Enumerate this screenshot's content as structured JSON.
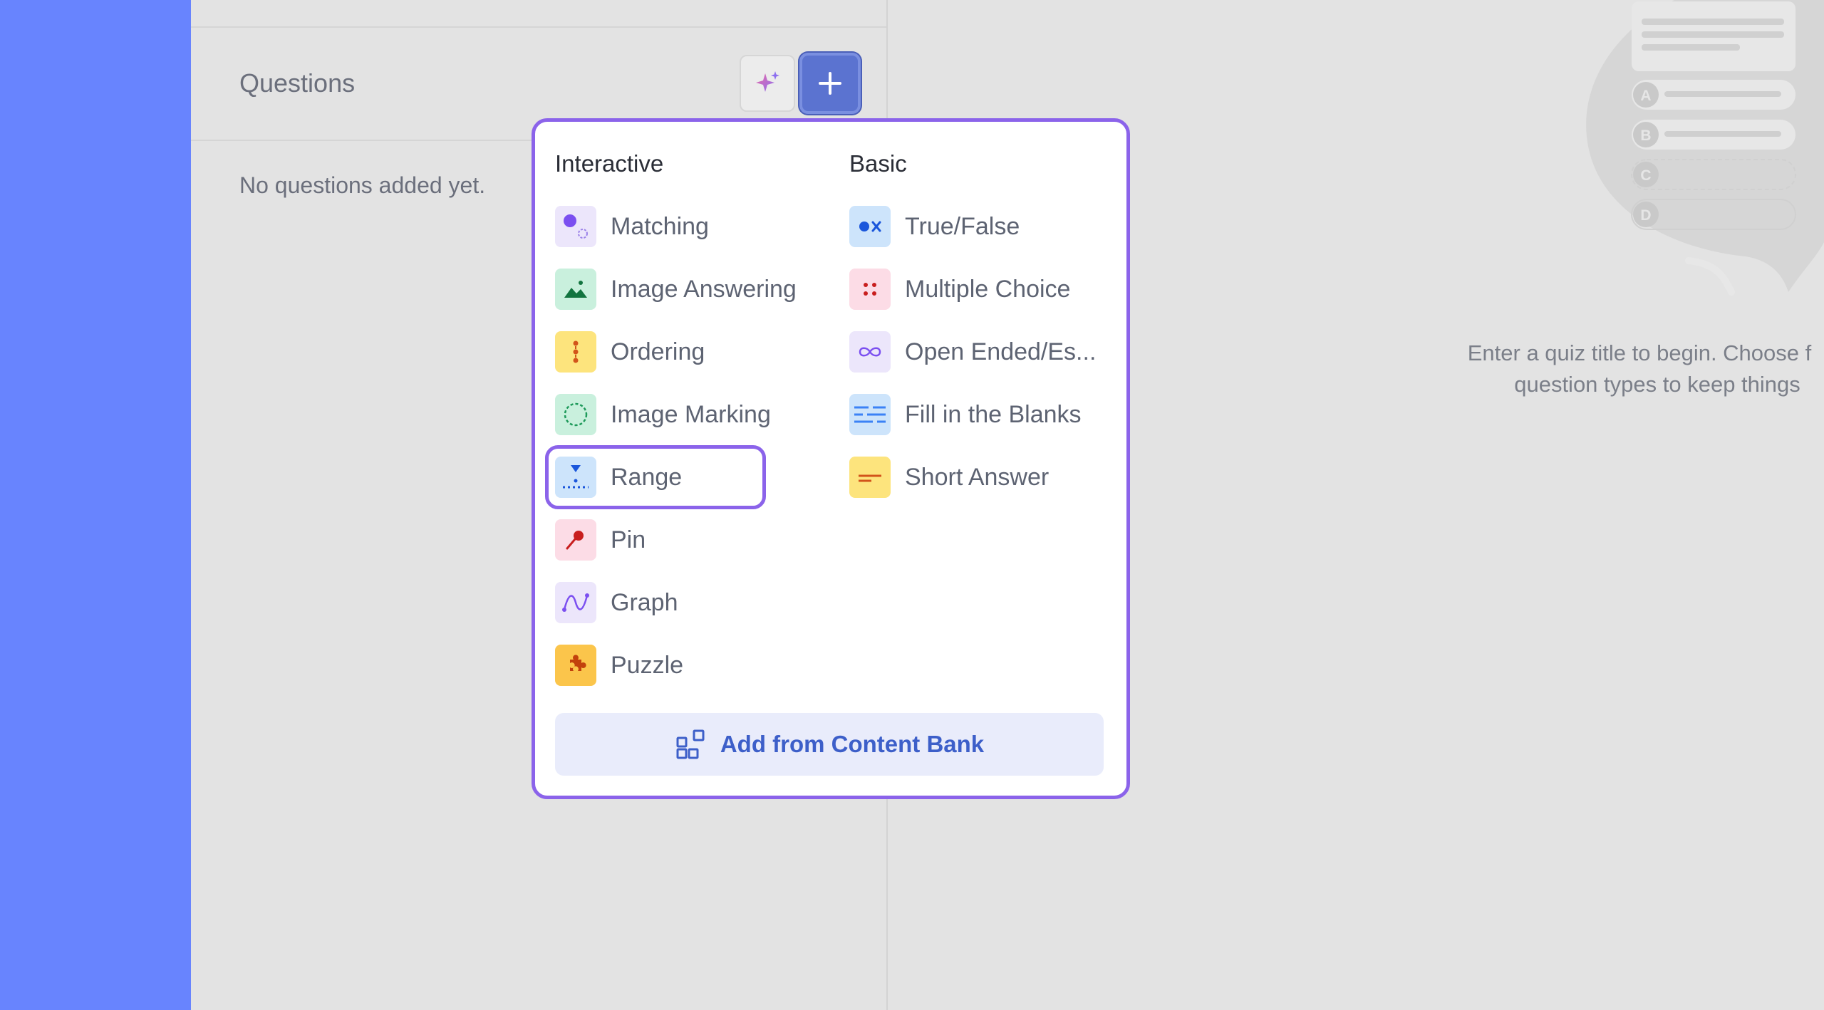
{
  "questions_panel": {
    "title": "Questions",
    "empty_message": "No questions added yet."
  },
  "preview": {
    "intro_line1": "Enter a quiz title to begin. Choose f",
    "intro_line2": "question types to keep things",
    "option_letters": [
      "A",
      "B",
      "C",
      "D"
    ]
  },
  "menu": {
    "interactive_heading": "Interactive",
    "basic_heading": "Basic",
    "interactive_items": [
      {
        "label": "Matching",
        "icon": "matching-icon"
      },
      {
        "label": "Image Answering",
        "icon": "image-answering-icon"
      },
      {
        "label": "Ordering",
        "icon": "ordering-icon"
      },
      {
        "label": "Image Marking",
        "icon": "image-marking-icon"
      },
      {
        "label": "Range",
        "icon": "range-icon"
      },
      {
        "label": "Pin",
        "icon": "pin-icon"
      },
      {
        "label": "Graph",
        "icon": "graph-icon"
      },
      {
        "label": "Puzzle",
        "icon": "puzzle-icon"
      }
    ],
    "basic_items": [
      {
        "label": "True/False",
        "icon": "true-false-icon"
      },
      {
        "label": "Multiple Choice",
        "icon": "multiple-choice-icon"
      },
      {
        "label": "Open Ended/Es...",
        "icon": "open-ended-icon"
      },
      {
        "label": "Fill in the Blanks",
        "icon": "fill-blanks-icon"
      },
      {
        "label": "Short Answer",
        "icon": "short-answer-icon"
      }
    ],
    "content_bank_label": "Add from Content Bank"
  },
  "colors": {
    "left_rail": "#6884fe",
    "accent": "#8b63ea",
    "primary_button": "#5b73d0",
    "content_bank_text": "#3d5fc9"
  }
}
